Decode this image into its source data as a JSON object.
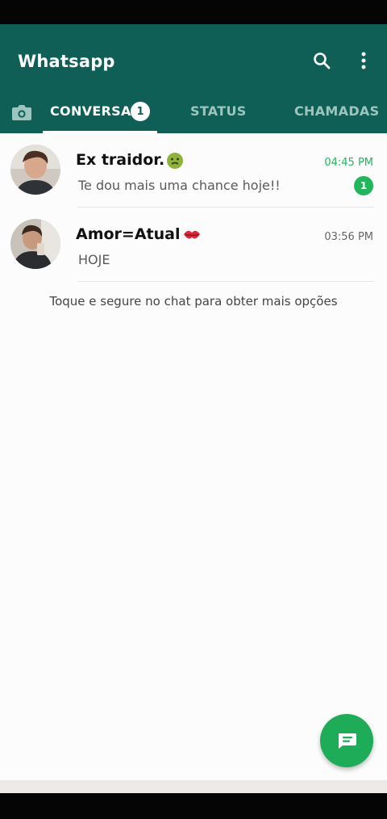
{
  "app": {
    "title": "Whatsapp"
  },
  "tabs": {
    "conversas": "CONVERSAS",
    "conversas_badge": "1",
    "status": "STATUS",
    "chamadas": "CHAMADAS"
  },
  "icons": {
    "search": "search-icon",
    "menu": "more-vert-icon",
    "camera": "camera-icon",
    "new_chat": "chat-icon"
  },
  "chats": [
    {
      "name": "Ex traidor.",
      "message": "Te dou mais uma chance hoje!!",
      "time": "04:45 PM",
      "unread": "1"
    },
    {
      "name": "Amor=Atual",
      "message": "HOJE",
      "time": "03:56 PM"
    }
  ],
  "hint": "Toque e segure no chat para obter mais opções",
  "colors": {
    "primary": "#0f5f57",
    "accent": "#22b65c",
    "fab": "#1fac59"
  }
}
